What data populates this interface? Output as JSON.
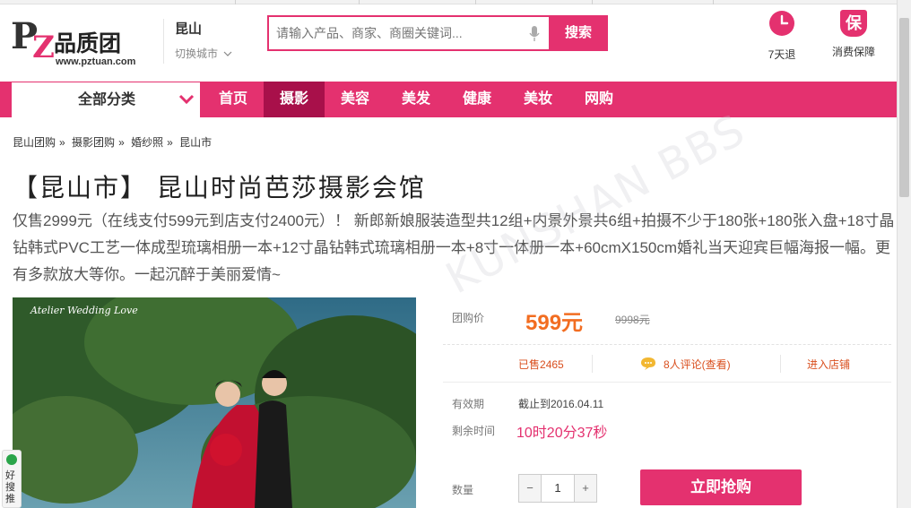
{
  "logo": {
    "brand_cn": "品质团",
    "url": "www.pztuan.com",
    "initials": "PZT"
  },
  "city": {
    "name": "昆山",
    "switch": "切换城市"
  },
  "search": {
    "placeholder": "请输入产品、商家、商圈关键词...",
    "button": "搜索"
  },
  "services": [
    {
      "icon": "clock-icon",
      "label": "7天退"
    },
    {
      "icon": "shield-badge-icon",
      "label": "消费保障",
      "badge": "保"
    }
  ],
  "nav": {
    "category": "全部分类",
    "items": [
      {
        "label": "首页",
        "active": false
      },
      {
        "label": "摄影",
        "active": true
      },
      {
        "label": "美容",
        "active": false
      },
      {
        "label": "美发",
        "active": false
      },
      {
        "label": "健康",
        "active": false
      },
      {
        "label": "美妆",
        "active": false
      },
      {
        "label": "网购",
        "active": false
      }
    ]
  },
  "breadcrumb": [
    "昆山团购",
    "»",
    "摄影团购",
    "»",
    "婚纱照",
    "»",
    "昆山市"
  ],
  "deal": {
    "title": "【昆山市】 昆山时尚芭莎摄影会馆",
    "description": "仅售2999元（在线支付599元到店支付2400元）！ 新郎新娘服装造型共12组+内景外景共6组+拍摄不少于180张+180张入盘+18寸晶钻韩式PVC工艺一体成型琉璃相册一本+12寸晶钻韩式琉璃相册一本+8寸一体册一本+60cmX150cm婚礼当天迎宾巨幅海报一幅。更有多款放大等你。一起沉醉于美丽爱情~",
    "photo_caption": "Atelier Wedding Love"
  },
  "info": {
    "price_label": "团购价",
    "price": "599元",
    "old_price": "9998元",
    "sold_prefix": "已售",
    "sold_count": "2465",
    "reviews": "8人评论(查看)",
    "shop_link": "进入店铺",
    "valid_label": "有效期",
    "valid_value": "截止到2016.04.11",
    "remain_label": "剩余时间",
    "remain_value": "10时20分37秒",
    "qty_label": "数量",
    "qty_minus": "−",
    "qty_value": "1",
    "qty_plus": "+",
    "buy_button": "立即抢购"
  },
  "watermark": "KUNSHAN BBS",
  "widget": {
    "label": "好搜推"
  },
  "colors": {
    "accent": "#e4316f",
    "nav_active": "#a8104a",
    "price": "#f26d21"
  }
}
